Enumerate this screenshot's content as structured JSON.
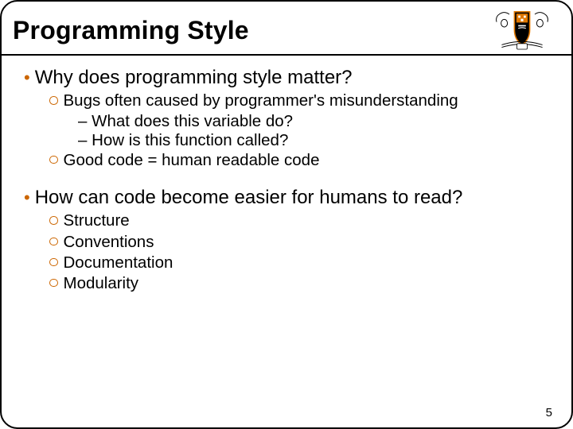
{
  "title": "Programming Style",
  "section1": {
    "heading": "Why does programming style matter?",
    "sub1": "Bugs often caused by programmer's misunderstanding",
    "sub1a": "– What does this variable do?",
    "sub1b": "– How is this function called?",
    "sub2": "Good code = human readable code"
  },
  "section2": {
    "heading": "How can code become easier for humans to read?",
    "items": {
      "i1": "Structure",
      "i2": "Conventions",
      "i3": "Documentation",
      "i4": "Modularity"
    }
  },
  "page_number": "5"
}
